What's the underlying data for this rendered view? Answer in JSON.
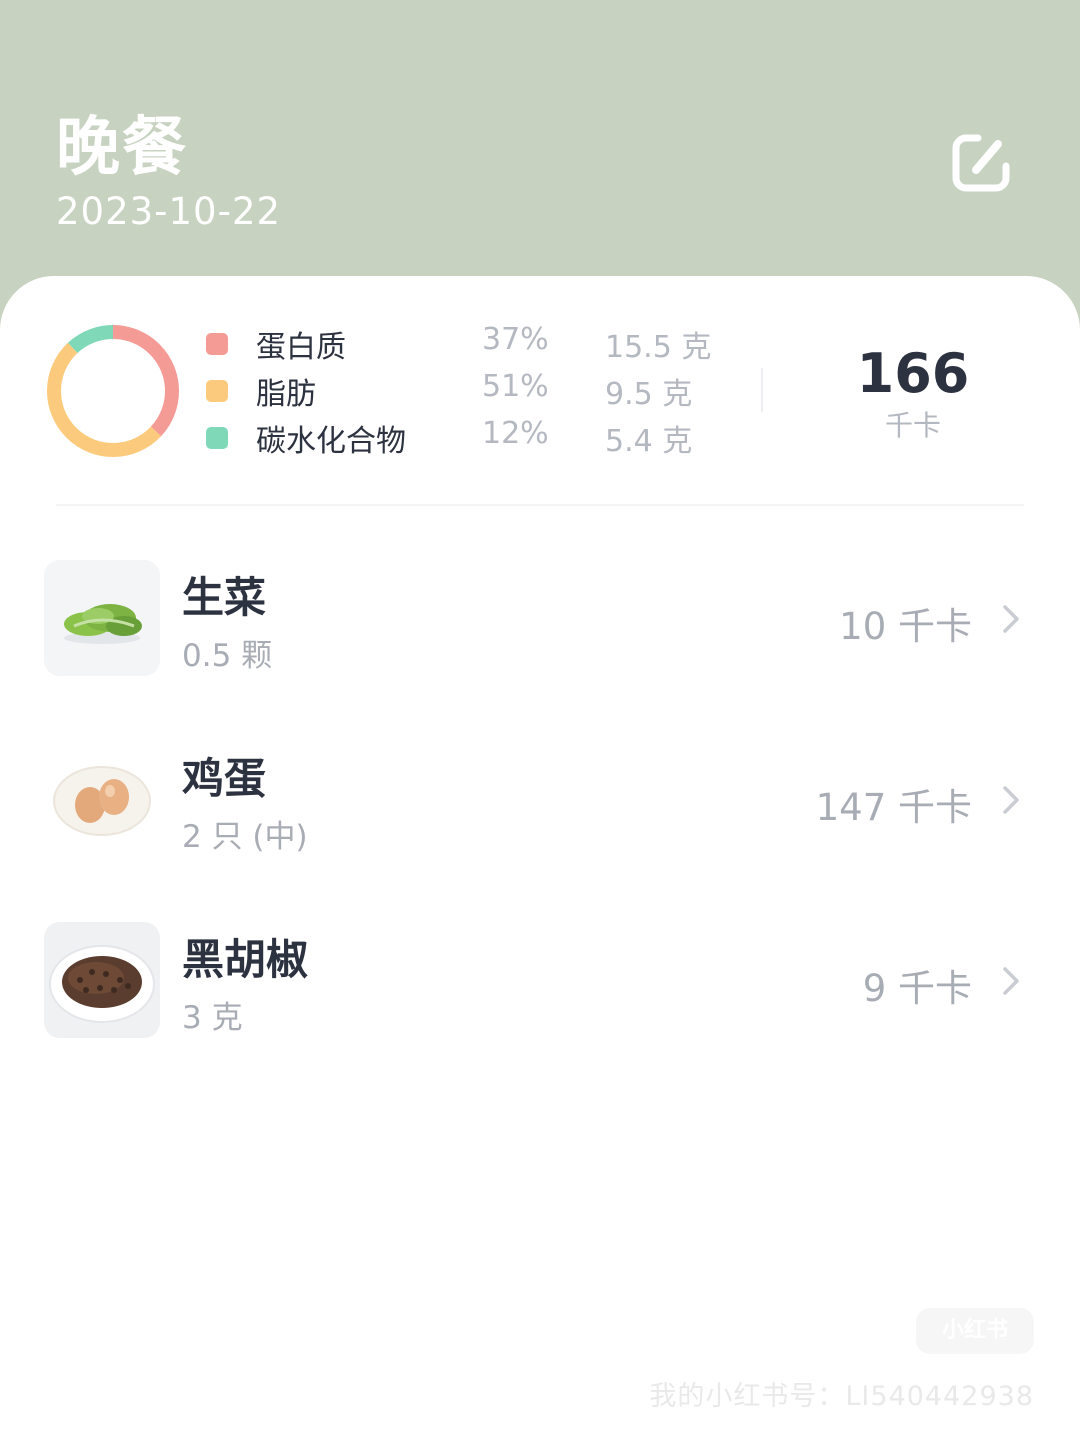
{
  "header": {
    "title": "晚餐",
    "date": "2023-10-22",
    "edit_icon": "edit-icon"
  },
  "summary": {
    "macros": [
      {
        "name": "蛋白质",
        "percent": "37%",
        "amount": "15.5 克",
        "color": "#f59b96"
      },
      {
        "name": "脂肪",
        "percent": "51%",
        "amount": "9.5 克",
        "color": "#fcca7c"
      },
      {
        "name": "碳水化合物",
        "percent": "12%",
        "amount": "5.4 克",
        "color": "#7fd8b8"
      }
    ],
    "total_kcal": "166",
    "kcal_unit": "千卡"
  },
  "foods": [
    {
      "name": "生菜",
      "quantity": "0.5 颗",
      "kcal": "10 千卡",
      "icon": "lettuce-icon"
    },
    {
      "name": "鸡蛋",
      "quantity": "2 只 (中)",
      "kcal": "147 千卡",
      "icon": "egg-icon"
    },
    {
      "name": "黑胡椒",
      "quantity": "3 克",
      "kcal": "9 千卡",
      "icon": "black-pepper-icon"
    }
  ],
  "watermark": {
    "logo": "小红书",
    "text": "我的小红书号：LI540442938"
  }
}
